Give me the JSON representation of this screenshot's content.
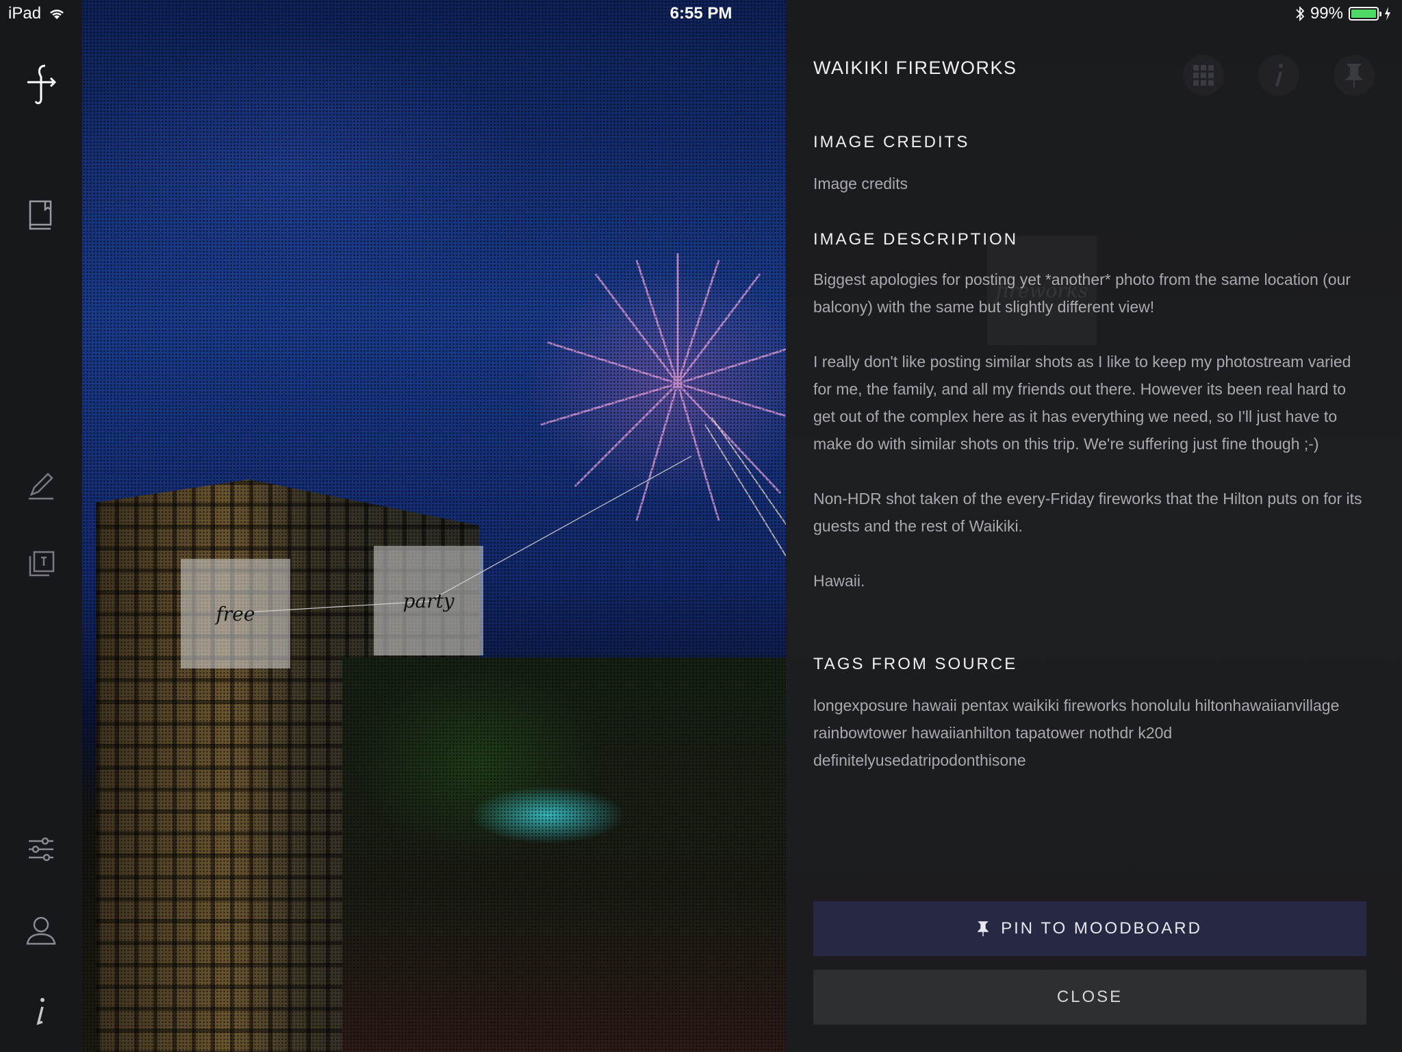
{
  "status_bar": {
    "device": "iPad",
    "time": "6:55 PM",
    "battery": "99%",
    "battery_level": 0.99
  },
  "sidebar": {
    "items": [
      {
        "icon": "logo-icon"
      },
      {
        "icon": "book-icon"
      },
      {
        "icon": "pencil-icon"
      },
      {
        "icon": "pinned-stack-icon"
      },
      {
        "icon": "sliders-icon"
      },
      {
        "icon": "user-icon"
      },
      {
        "icon": "info-icon"
      }
    ]
  },
  "photo": {
    "tags": [
      {
        "label": "free"
      },
      {
        "label": "party"
      }
    ]
  },
  "panel": {
    "title": "WAIKIKI FIREWORKS",
    "credits_heading": "IMAGE CREDITS",
    "credits_text": "Image credits",
    "description_heading": "IMAGE DESCRIPTION",
    "description_paragraphs": [
      "Biggest apologies for posting yet *another* photo from the same location (our balcony) with the same but slightly different view!",
      "I really don't like posting similar shots as I like to keep my photostream varied for me, the family, and all my friends out there. However its been real hard to get out of the complex here as it has everything we need, so I'll just have to make do with similar shots on this trip.  We're suffering just fine though ;-)",
      "Non-HDR shot taken of the every-Friday fireworks that the Hilton puts on for its guests and the rest of Waikiki.",
      "Hawaii."
    ],
    "tags_heading": "TAGS FROM SOURCE",
    "tags_text": "longexposure hawaii pentax waikiki fireworks honolulu hiltonhawaiianvillage rainbowtower hawaiianhilton tapatower nothdr k20d definitelyusedatripodonthisone",
    "ghost_tag": "fireworks",
    "top_actions": [
      "grid-icon",
      "info-icon",
      "pin-icon"
    ]
  },
  "buttons": {
    "pin_label": "PIN TO MOODBOARD",
    "close_label": "CLOSE"
  },
  "colors": {
    "pin_button": "#262844",
    "close_button": "#2e2f33",
    "battery": "#4cd964"
  }
}
